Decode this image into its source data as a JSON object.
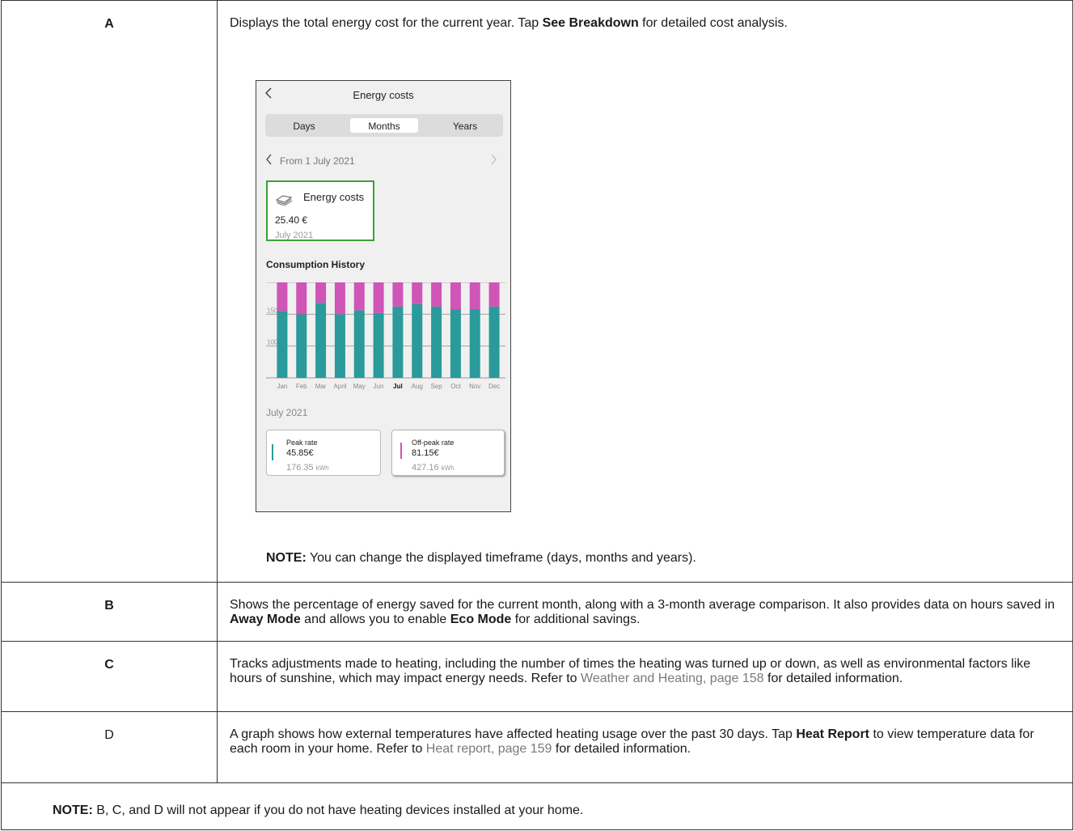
{
  "rows": [
    {
      "key": "A",
      "desc_parts": [
        "Displays the total energy cost for the current year. Tap ",
        "See Breakdown",
        " for detailed cost analysis."
      ],
      "note_label": "NOTE:",
      "note_text": " You can change the displayed timeframe (days, months and years)."
    },
    {
      "key": "B",
      "desc_parts": [
        "Shows the percentage of energy saved for the current month, along with a 3-month average comparison. It also provides data on hours saved in ",
        "Away Mode",
        " and allows you to enable ",
        "Eco Mode",
        " for additional savings."
      ]
    },
    {
      "key": "C",
      "desc_parts": [
        "Tracks adjustments made to heating, including the number of times the heating was turned up or down, as well as environmental factors like hours of sunshine, which may impact energy needs. Refer to ",
        "Weather and Heating, page 158",
        " for detailed information."
      ]
    },
    {
      "key": "D",
      "desc_parts": [
        "A graph shows how external temperatures have affected heating usage over the past 30 days. Tap ",
        "Heat Report",
        " to view temperature data for each room in your home. Refer to ",
        "Heat report, page 159",
        " for detailed information."
      ]
    }
  ],
  "footer_note": {
    "label": "NOTE:",
    "text": " B, C, and D will not appear if you do not have heating devices installed at your home."
  },
  "phone": {
    "title": "Energy costs",
    "tabs": [
      "Days",
      "Months",
      "Years"
    ],
    "selected_tab": "Months",
    "period_label": "From 1 July 2021",
    "card": {
      "title": "Energy costs",
      "value": "25.40 €",
      "period": "July 2021",
      "icon": "banknotes-icon",
      "border_color": "#3aa13a"
    },
    "history_title": "Consumption History",
    "period2": "July 2021",
    "peak": {
      "label": "Peak rate",
      "cost": "45.85€",
      "kwh": "176.35",
      "unit": "kWh",
      "color": "#2a9a9a"
    },
    "offpeak": {
      "label": "Off-peak rate",
      "cost": "81.15€",
      "kwh": "427.16",
      "unit": "kWh",
      "color": "#cf55b6"
    }
  },
  "chart_data": {
    "type": "bar",
    "stacked": true,
    "title": "Consumption History",
    "categories": [
      "Jan",
      "Feb",
      "Mar",
      "April",
      "May",
      "Jun",
      "Jul",
      "Aug",
      "Sep",
      "Oct",
      "Nov",
      "Dec"
    ],
    "highlight": "Jul",
    "yticks": [
      100,
      150,
      200
    ],
    "ylim": [
      50,
      200
    ],
    "series": [
      {
        "values": [
          105,
          100,
          118,
          100,
          106,
          102,
          112,
          116,
          112,
          108,
          108,
          112
        ],
        "color": "#2a9a9a"
      },
      {
        "values": [
          57,
          72,
          38,
          73,
          56,
          68,
          50,
          42,
          52,
          64,
          65,
          53
        ],
        "color": "#cf55b6"
      }
    ],
    "grid": true
  }
}
